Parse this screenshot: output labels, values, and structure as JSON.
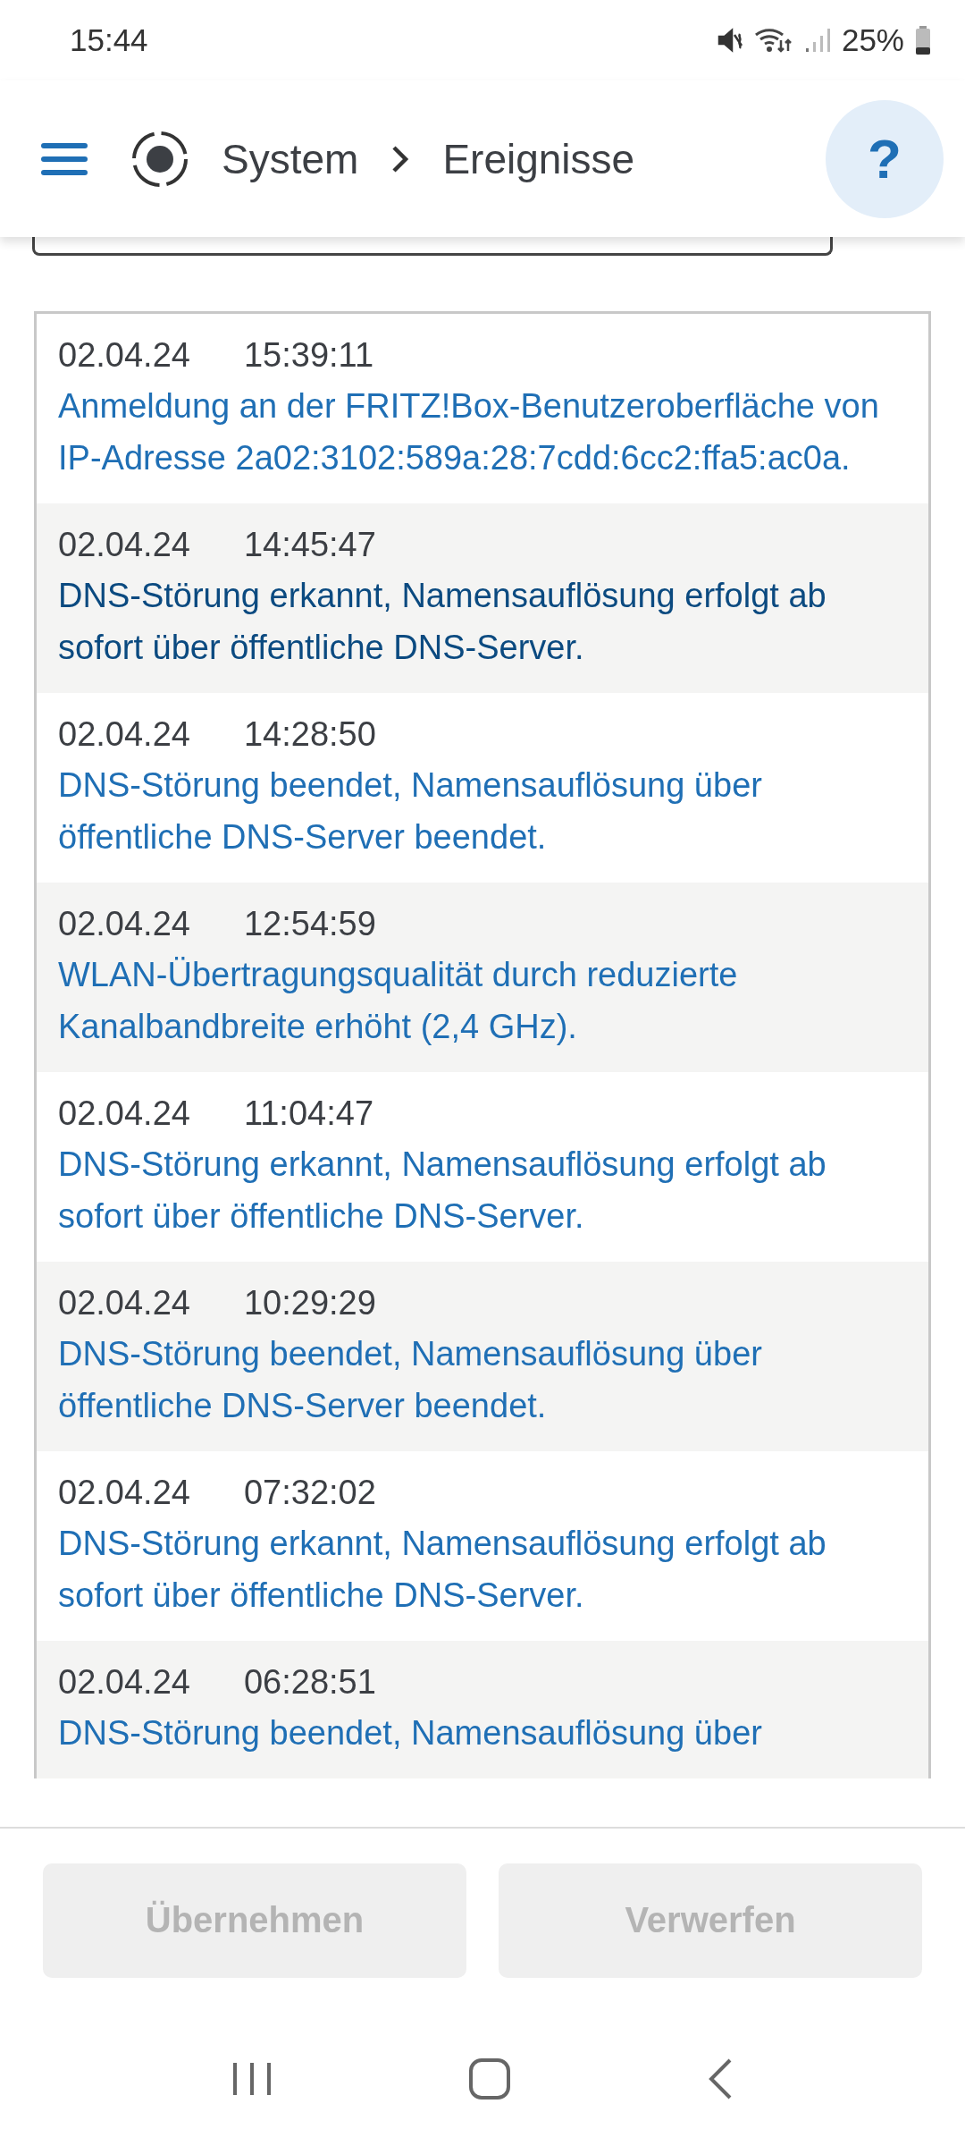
{
  "status_bar": {
    "time": "15:44",
    "battery": "25%"
  },
  "header": {
    "breadcrumb": [
      "System",
      "Ereignisse"
    ],
    "help": "?"
  },
  "events": [
    {
      "date": "02.04.24",
      "time": "15:39:11",
      "message": "Anmeldung an der FRITZ!Box-Benutzeroberfläche von IP-Adresse 2a02:3102:589a:28:7cdd:6cc2:ffa5:ac0a.",
      "color": "#1f6fb5"
    },
    {
      "date": "02.04.24",
      "time": "14:45:47",
      "message": "DNS-Störung erkannt, Namensauflösung erfolgt ab sofort über öffentliche DNS-Server.",
      "color": "#0b4a80"
    },
    {
      "date": "02.04.24",
      "time": "14:28:50",
      "message": "DNS-Störung beendet, Namensauflösung über öffentliche DNS-Server beendet.",
      "color": "#1f6fb5"
    },
    {
      "date": "02.04.24",
      "time": "12:54:59",
      "message": "WLAN-Übertragungsqualität durch reduzierte Kanalbandbreite erhöht (2,4 GHz).",
      "color": "#1f6fb5"
    },
    {
      "date": "02.04.24",
      "time": "11:04:47",
      "message": "DNS-Störung erkannt, Namensauflösung erfolgt ab sofort über öffentliche DNS-Server.",
      "color": "#1f6fb5"
    },
    {
      "date": "02.04.24",
      "time": "10:29:29",
      "message": "DNS-Störung beendet, Namensauflösung über öffentliche DNS-Server beendet.",
      "color": "#1f6fb5"
    },
    {
      "date": "02.04.24",
      "time": "07:32:02",
      "message": "DNS-Störung erkannt, Namensauflösung erfolgt ab sofort über öffentliche DNS-Server.",
      "color": "#1f6fb5"
    },
    {
      "date": "02.04.24",
      "time": "06:28:51",
      "message": "DNS-Störung beendet, Namensauflösung über",
      "color": "#1f6fb5"
    }
  ],
  "buttons": [
    {
      "label": "Übernehmen",
      "disabled": true
    },
    {
      "label": "Verwerfen",
      "disabled": true
    }
  ]
}
